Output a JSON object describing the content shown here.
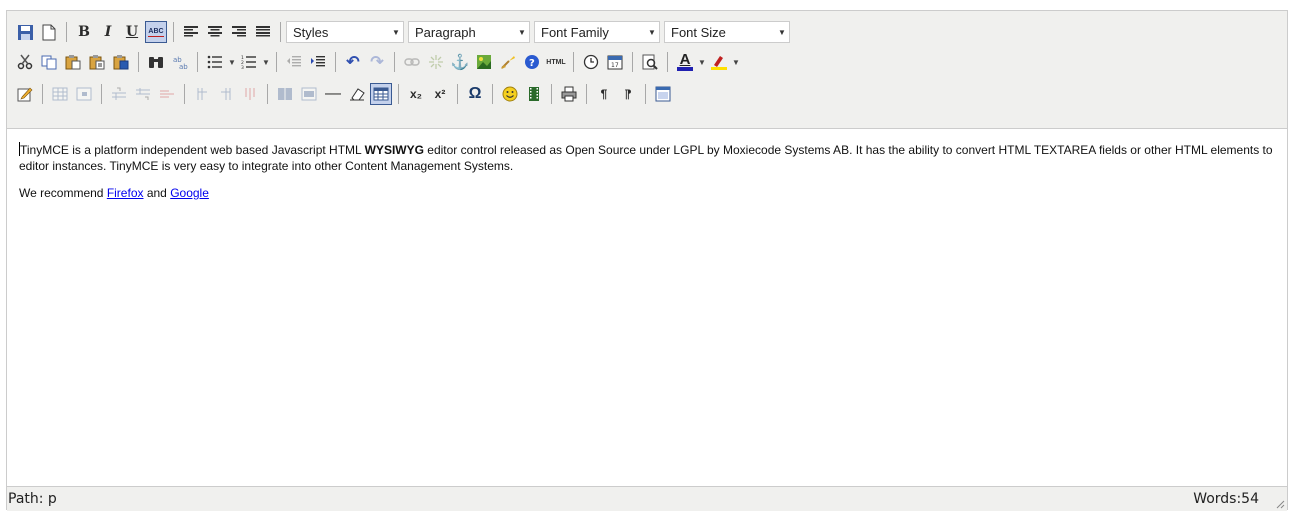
{
  "toolbar": {
    "styles_label": "Styles",
    "paragraph_label": "Paragraph",
    "font_family_label": "Font Family",
    "font_size_label": "Font Size",
    "bold_glyph": "B",
    "italic_glyph": "I",
    "underline_glyph": "U",
    "strikethrough_glyph": "ABC",
    "html_glyph": "HTML",
    "text_color_glyph": "A",
    "text_color": "#2020b0",
    "highlight_color": "#ffe000",
    "subscript_glyph": "x₂",
    "superscript_glyph": "x²",
    "charmap_glyph": "Ω",
    "find_glyph": "⚲",
    "anchor_glyph": "⚓",
    "emotion_glyph": "☺",
    "ltr_glyph": "¶",
    "rtl_glyph": "¶",
    "undo_glyph": "↶",
    "redo_glyph": "↷",
    "hr_glyph": "—"
  },
  "content": {
    "p1_pre": "TinyMCE is a platform independent web based Javascript HTML ",
    "p1_bold": "WYSIWYG",
    "p1_post": " editor control released as Open Source under LGPL by Moxiecode Systems AB. It has the ability to convert HTML TEXTAREA fields or other HTML elements to editor instances. TinyMCE is very easy to integrate into other Content Management Systems.",
    "p2_pre": "We recommend ",
    "link1": "Firefox",
    "p2_mid": " and ",
    "link2": "Google"
  },
  "status": {
    "path": "Path: p",
    "words": "Words:54"
  }
}
